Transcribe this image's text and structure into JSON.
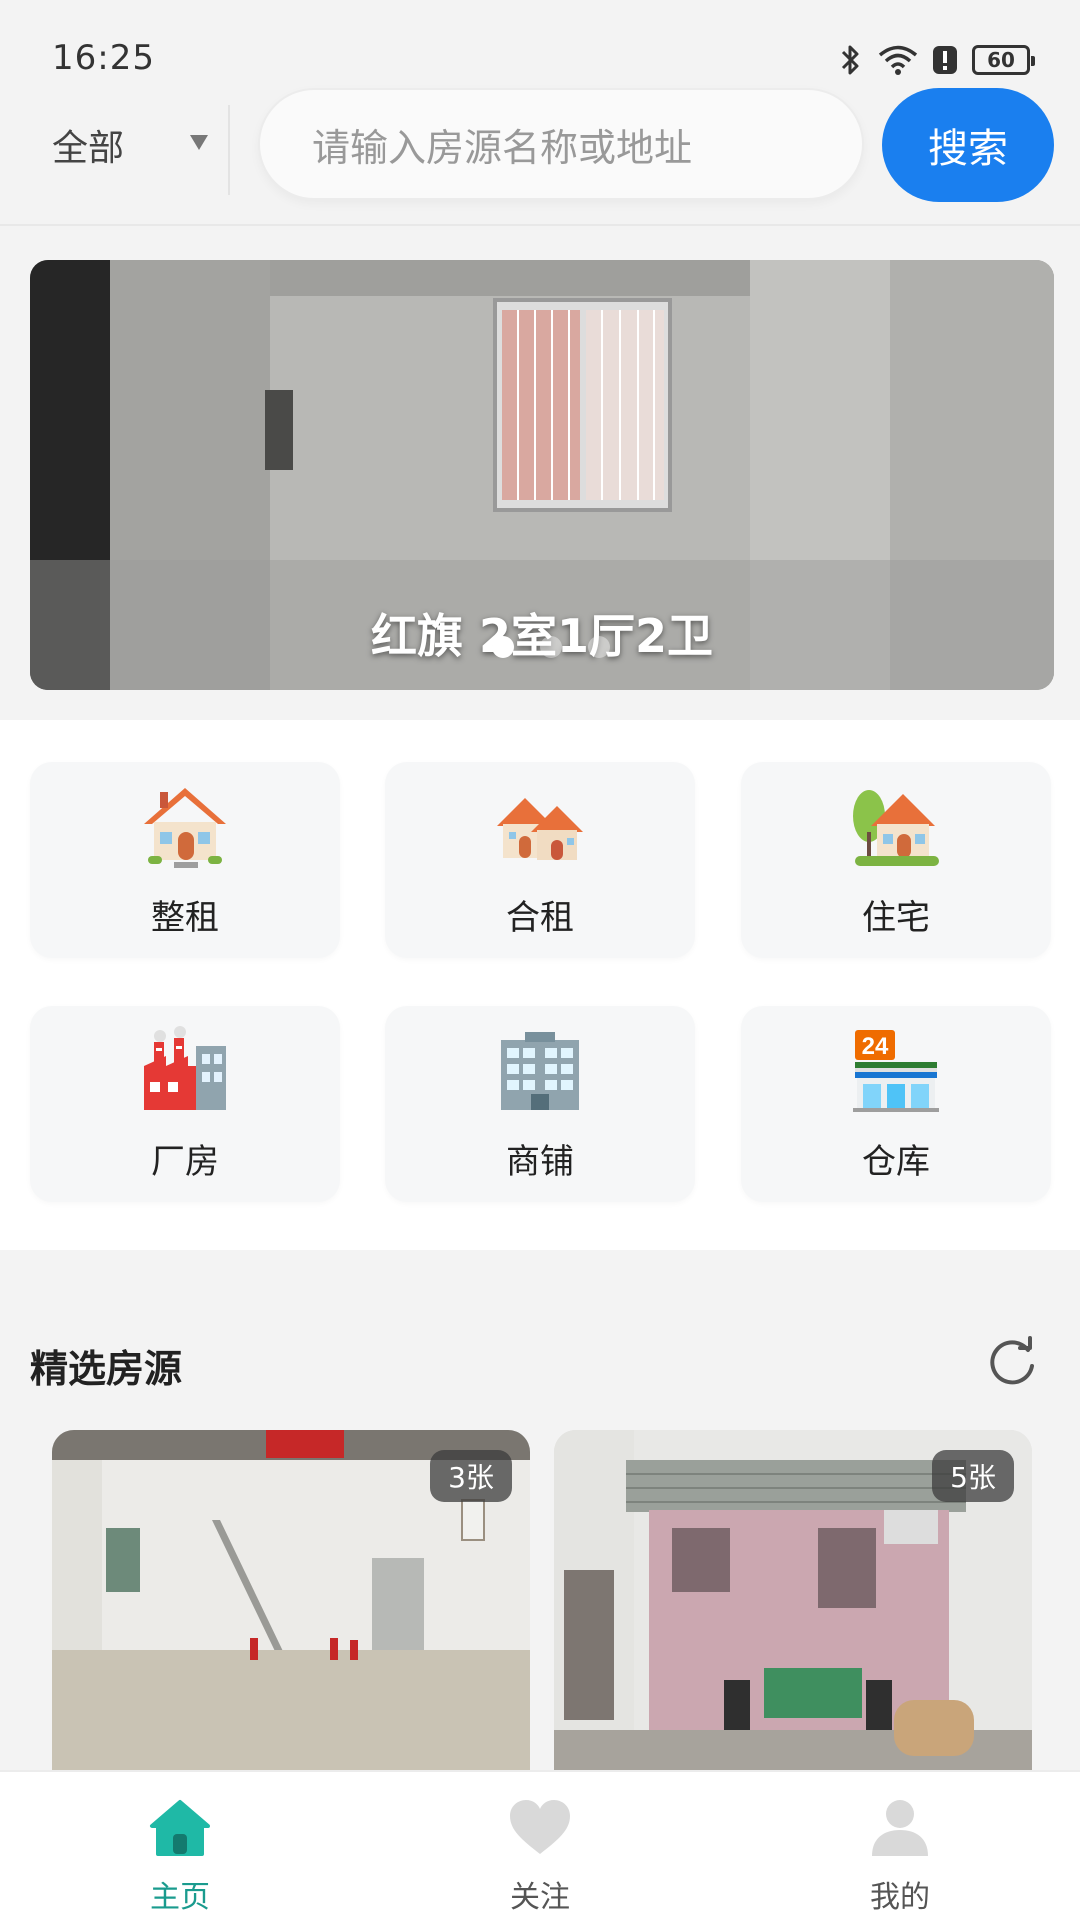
{
  "status_bar": {
    "time": "16:25",
    "battery": "60"
  },
  "search": {
    "region": "全部",
    "placeholder": "请输入房源名称或地址",
    "button": "搜索"
  },
  "banner": {
    "caption": "红旗 2室1厅2卫",
    "slide_count": 3,
    "active_slide": 1
  },
  "categories": [
    {
      "label": "整租",
      "icon": "house-icon"
    },
    {
      "label": "合租",
      "icon": "houses-icon"
    },
    {
      "label": "住宅",
      "icon": "house-garden-icon"
    },
    {
      "label": "厂房",
      "icon": "factory-icon"
    },
    {
      "label": "商铺",
      "icon": "office-building-icon"
    },
    {
      "label": "仓库",
      "icon": "convenience-store-icon"
    }
  ],
  "featured": {
    "title": "精选房源",
    "listings": [
      {
        "photo_count": "3张"
      },
      {
        "photo_count": "5张"
      }
    ]
  },
  "bottom_nav": [
    {
      "label": "主页",
      "icon": "home-icon",
      "active": true
    },
    {
      "label": "关注",
      "icon": "heart-icon",
      "active": false
    },
    {
      "label": "我的",
      "icon": "user-icon",
      "active": false
    }
  ],
  "colors": {
    "accent": "#1a7fef",
    "nav_active": "#1a9b8e"
  }
}
